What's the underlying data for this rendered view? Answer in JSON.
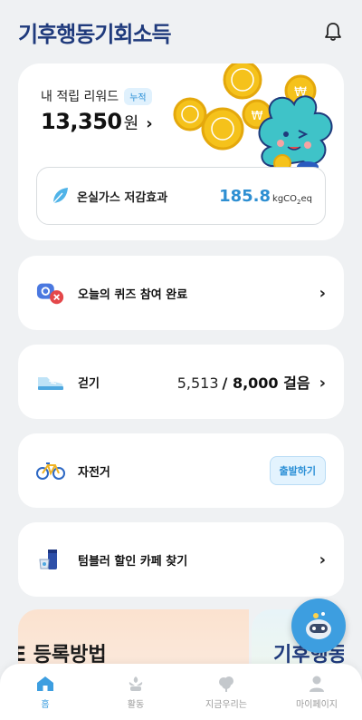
{
  "header": {
    "logo_text": "기후행동기회소득",
    "bell_icon": "bell-icon"
  },
  "reward": {
    "title": "내 적립 리워드",
    "badge": "누적",
    "amount": "13,350",
    "unit": "원",
    "co2": {
      "label": "온실가스 저감효과",
      "value": "185.8",
      "unit_prefix": "kgCO",
      "unit_sub": "2",
      "unit_suffix": "eq"
    }
  },
  "rows": [
    {
      "label": "오늘의 퀴즈 참여 완료",
      "icon": "quiz-icon"
    },
    {
      "label": "걷기",
      "icon": "shoe-icon",
      "current": "5,513",
      "goal": "/ 8,000 걸음"
    },
    {
      "label": "자전거",
      "icon": "bicycle-icon",
      "button": "출발하기"
    },
    {
      "label": "텀블러 할인 카페 찾기",
      "icon": "tumbler-icon"
    }
  ],
  "banner": {
    "left_text": "E 등록방법",
    "right_text": "기후행동"
  },
  "tabs": [
    {
      "label": "홈",
      "icon": "home-icon",
      "active": true
    },
    {
      "label": "활동",
      "icon": "activity-icon",
      "active": false
    },
    {
      "label": "지금우리는",
      "icon": "tree-icon",
      "active": false
    },
    {
      "label": "마이페이지",
      "icon": "person-icon",
      "active": false
    }
  ],
  "colors": {
    "accent": "#3d9ee0",
    "logo": "#1f3a7c",
    "background": "#eff1f3"
  }
}
